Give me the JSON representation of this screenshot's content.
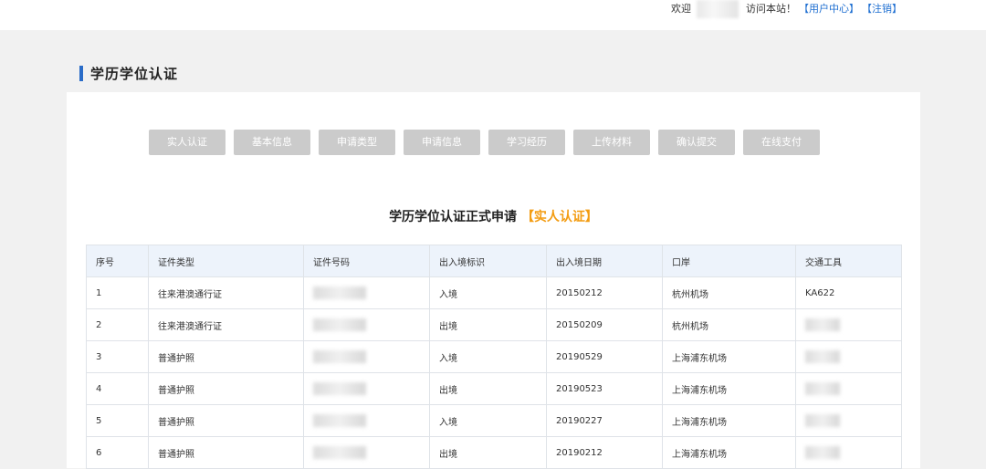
{
  "header": {
    "welcome": "欢迎",
    "visit_text": "访问本站！",
    "user_center": "【用户中心】",
    "logout": "【注销】"
  },
  "page": {
    "title": "学历学位认证"
  },
  "steps": [
    "实人认证",
    "基本信息",
    "申请类型",
    "申请信息",
    "学习经历",
    "上传材料",
    "确认提交",
    "在线支付"
  ],
  "form": {
    "title": "学历学位认证正式申请",
    "stage": "【实人认证】"
  },
  "table": {
    "columns": [
      "序号",
      "证件类型",
      "证件号码",
      "出入境标识",
      "出入境日期",
      "口岸",
      "交通工具"
    ],
    "rows": [
      [
        "1",
        "往来港澳通行证",
        "",
        "入境",
        "20150212",
        "杭州机场",
        "KA622"
      ],
      [
        "2",
        "往来港澳通行证",
        "",
        "出境",
        "20150209",
        "杭州机场",
        ""
      ],
      [
        "3",
        "普通护照",
        "",
        "入境",
        "20190529",
        "上海浦东机场",
        ""
      ],
      [
        "4",
        "普通护照",
        "",
        "出境",
        "20190523",
        "上海浦东机场",
        ""
      ],
      [
        "5",
        "普通护照",
        "",
        "入境",
        "20190227",
        "上海浦东机场",
        ""
      ],
      [
        "6",
        "普通护照",
        "",
        "出境",
        "20190212",
        "上海浦东机场",
        ""
      ]
    ]
  }
}
